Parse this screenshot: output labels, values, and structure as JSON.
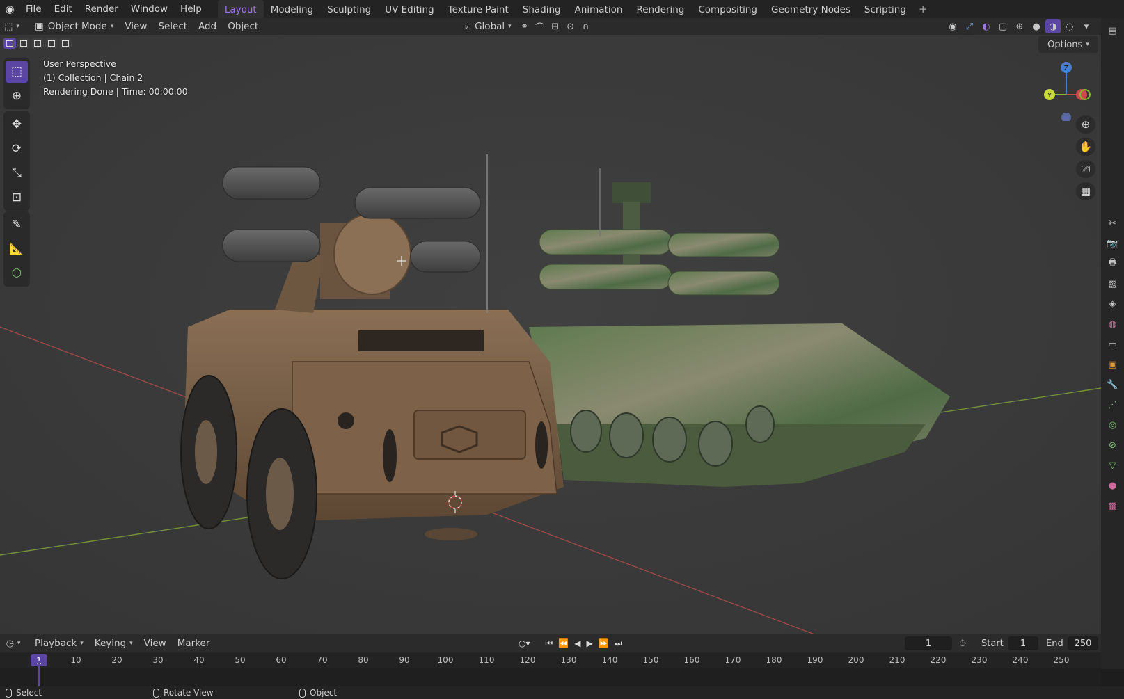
{
  "topbar": {
    "menus": [
      "File",
      "Edit",
      "Render",
      "Window",
      "Help"
    ],
    "workspaces": [
      "Layout",
      "Modeling",
      "Sculpting",
      "UV Editing",
      "Texture Paint",
      "Shading",
      "Animation",
      "Rendering",
      "Compositing",
      "Geometry Nodes",
      "Scripting"
    ],
    "active_workspace": "Layout",
    "add_tab": "+"
  },
  "header": {
    "mode": "Object Mode",
    "menus": [
      "View",
      "Select",
      "Add",
      "Object"
    ],
    "transform_orientation": "Global"
  },
  "viewport": {
    "overlay_lines": [
      "User Perspective",
      "(1) Collection | Chain 2",
      "Rendering Done | Time: 00:00.00"
    ],
    "options_label": "Options",
    "gizmo": {
      "z": "Z",
      "y": "Y"
    },
    "colors": {
      "accent": "#5b47a3",
      "x_axis": "#c94a4a",
      "y_axis": "#8bb833",
      "z_axis": "#4a7fd0"
    }
  },
  "timeline": {
    "menus": [
      "Playback",
      "Keying",
      "View",
      "Marker"
    ],
    "current_frame": "1",
    "start_label": "Start",
    "start_value": "1",
    "end_label": "End",
    "end_value": "250",
    "ticks": [
      "10",
      "20",
      "30",
      "40",
      "50",
      "60",
      "70",
      "80",
      "90",
      "100",
      "110",
      "120",
      "130",
      "140",
      "150",
      "160",
      "170",
      "180",
      "190",
      "200",
      "210",
      "220",
      "230",
      "240",
      "250"
    ],
    "frame_badge": "1"
  },
  "statusbar": {
    "items": [
      "Select",
      "Rotate View",
      "Object"
    ]
  }
}
